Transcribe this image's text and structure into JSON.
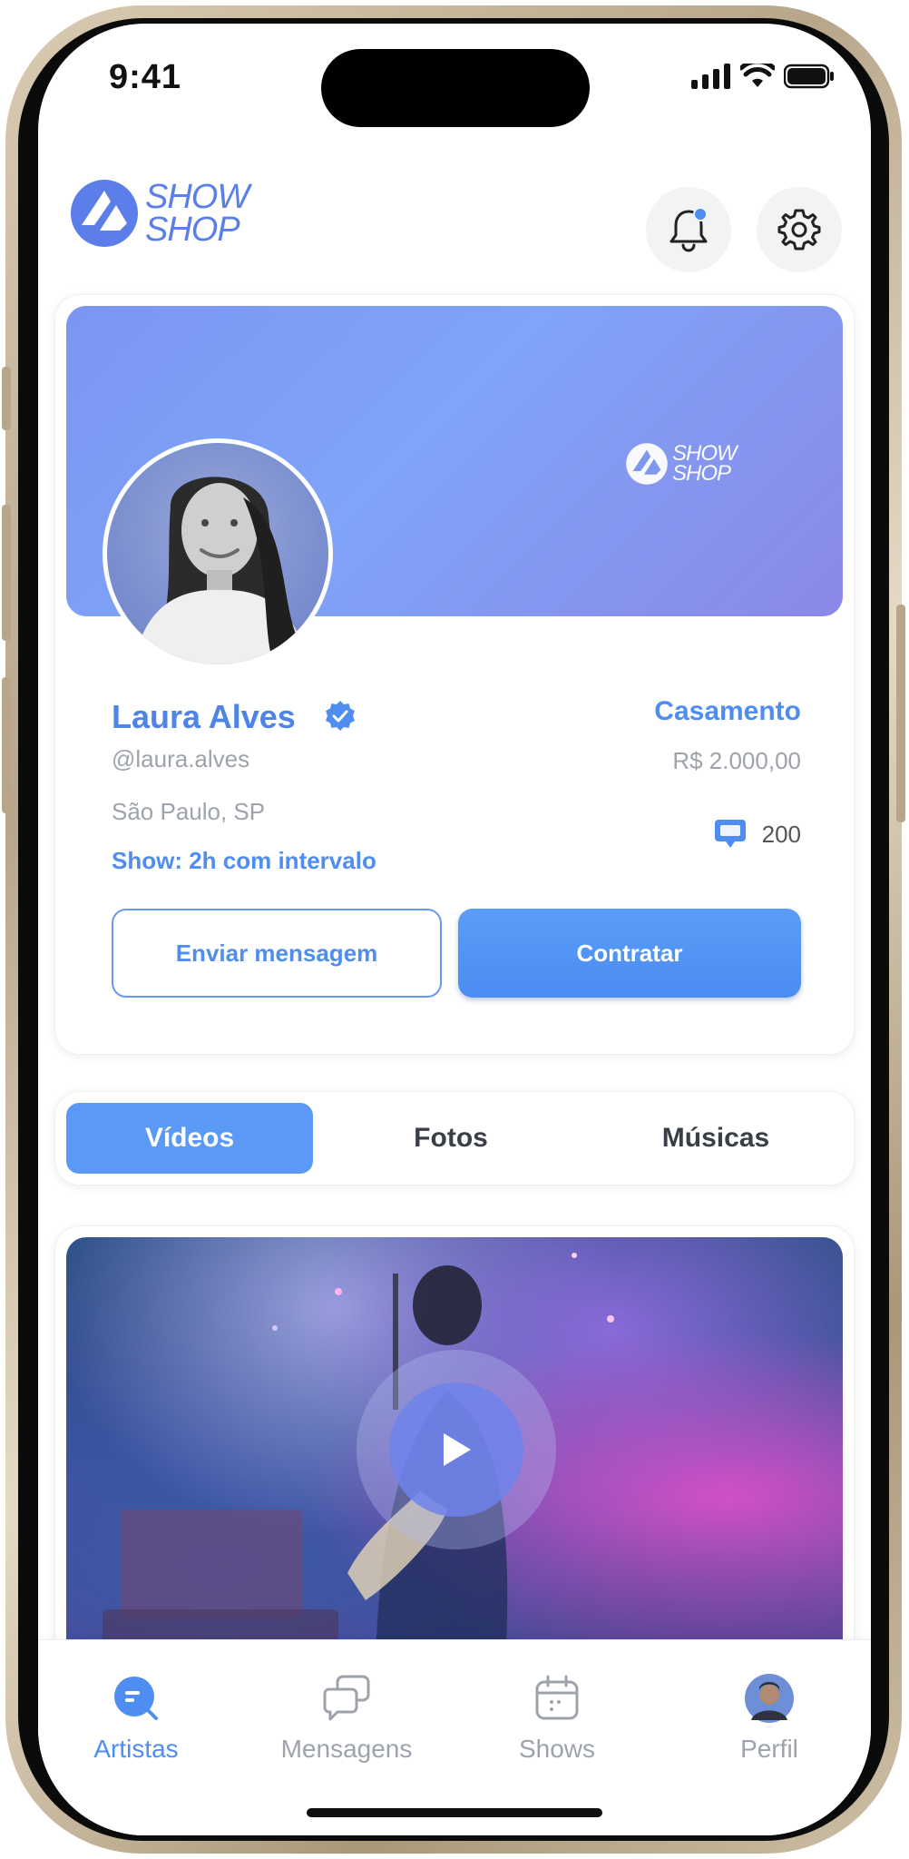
{
  "status_bar": {
    "time": "9:41"
  },
  "brand": {
    "logo_line1": "SHOW",
    "logo_line2": "SHOP",
    "accent_color": "#4f8df0"
  },
  "profile": {
    "name": "Laura Alves",
    "handle": "@laura.alves",
    "location": "São Paulo, SP",
    "show_info": "Show: 2h com intervalo",
    "event_type": "Casamento",
    "price": "R$ 2.000,00",
    "comments_count": "200",
    "verified": true
  },
  "actions": {
    "message_label": "Enviar mensagem",
    "hire_label": "Contratar"
  },
  "tabs": [
    {
      "label": "Vídeos",
      "active": true
    },
    {
      "label": "Fotos",
      "active": false
    },
    {
      "label": "Músicas",
      "active": false
    }
  ],
  "bottom_nav": [
    {
      "label": "Artistas",
      "icon": "search-chat-icon",
      "active": true
    },
    {
      "label": "Mensagens",
      "icon": "chat-bubbles-icon",
      "active": false
    },
    {
      "label": "Shows",
      "icon": "calendar-icon",
      "active": false
    },
    {
      "label": "Perfil",
      "icon": "avatar",
      "active": false
    }
  ]
}
